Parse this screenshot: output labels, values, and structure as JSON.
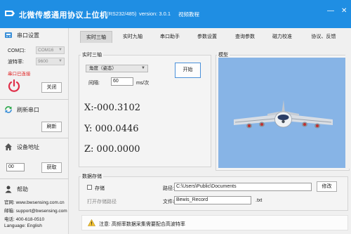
{
  "titlebar": {
    "title": "北微传感通用协议上位机",
    "protocol": "(RS232/485)",
    "version": "version: 3.0.1",
    "tutorial": "视频教程",
    "minimize": "—",
    "close": "✕"
  },
  "sidebar": {
    "serial_section": "串口设置",
    "com_label": "COM口:",
    "com_value": "COM16",
    "baud_label": "波特率:",
    "baud_value": "9600",
    "status": "串口已连接",
    "close_button": "关闭",
    "refresh_section": "刷新串口",
    "refresh_button": "刷新",
    "address_section": "设备地址",
    "address_value": "00",
    "get_button": "获取",
    "help_section": "帮助",
    "website": "官网:  www.bwsensing.com.cn",
    "email": "邮箱:  support@bwsensing.com",
    "phone": "电话:  400-618-0510",
    "language": "Language:    English"
  },
  "tabs": [
    "实时三轴",
    "实时九轴",
    "串口助手",
    "参数设置",
    "查询参数",
    "磁力校准",
    "协议、反馈"
  ],
  "realtime": {
    "group_title": "实时三轴",
    "mode_select": "角度（姿态）",
    "interval_label": "间隔:",
    "interval_value": "60",
    "interval_unit": "ms/次",
    "start_button": "开始",
    "x_readout": "X:-000.3102",
    "y_readout": "Y:  000.0446",
    "z_readout": "Z:  000.0000"
  },
  "model": {
    "title": "模型"
  },
  "storage": {
    "group_title": "数据存储",
    "store_checkbox": "存储",
    "open_path": "打开存储路径",
    "path_label": "路径:",
    "path_value": "C:\\Users\\Public\\Documents",
    "modify_button": "修改",
    "filename_label": "文件名:",
    "filename_value": "Bewis_Record",
    "extension": ".txt"
  },
  "notice": {
    "text": "注意: 高频率数据采集需要配合高波特率"
  },
  "colors": {
    "titlebar": "#1f8ee3",
    "sky": "#87b4e6",
    "status_red": "#e02020"
  }
}
